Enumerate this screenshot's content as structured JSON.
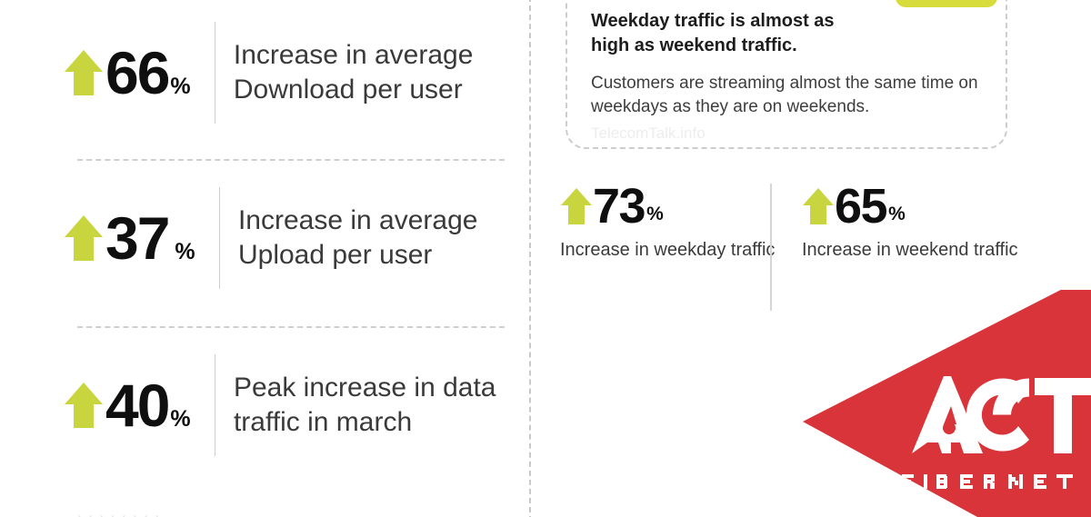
{
  "theme": {
    "arrow_green": "#c8d53f",
    "pill_yellow": "#d8dc3a",
    "brand_red": "#d9343a",
    "text_dark": "#1d1d1d",
    "text_body": "#3a3a3a",
    "divider_gray": "#cfcfcf"
  },
  "left_column": {
    "stats": [
      {
        "arrow": "arrow-up-icon",
        "value": "66",
        "unit": "%",
        "description": "Increase in average Download per user"
      },
      {
        "arrow": "arrow-up-icon",
        "value": "37",
        "unit": "%",
        "description": "Increase in average Upload per user"
      },
      {
        "arrow": "arrow-up-icon",
        "value": "40",
        "unit": "%",
        "description": "Peak increase in data traffic in march"
      }
    ],
    "cut_off_text": "· ·  ·  ·   ·    ·     ·   ·"
  },
  "right_column": {
    "callout": {
      "title": "Weekday traffic is almost as high as weekend traffic.",
      "body": "Customers are streaming almost the same time on weekdays as they are on weekends.",
      "watermark": "TelecomTalk.info"
    },
    "mini_stats": [
      {
        "arrow": "arrow-up-icon",
        "value": "73",
        "unit": "%",
        "label": "Increase in weekday traffic"
      },
      {
        "arrow": "arrow-up-icon",
        "value": "65",
        "unit": "%",
        "label": "Increase in weekend traffic"
      }
    ]
  },
  "logo": {
    "name": "act-fibernet-logo",
    "wordmark": "ACT",
    "subtext": "FIBERNET"
  }
}
